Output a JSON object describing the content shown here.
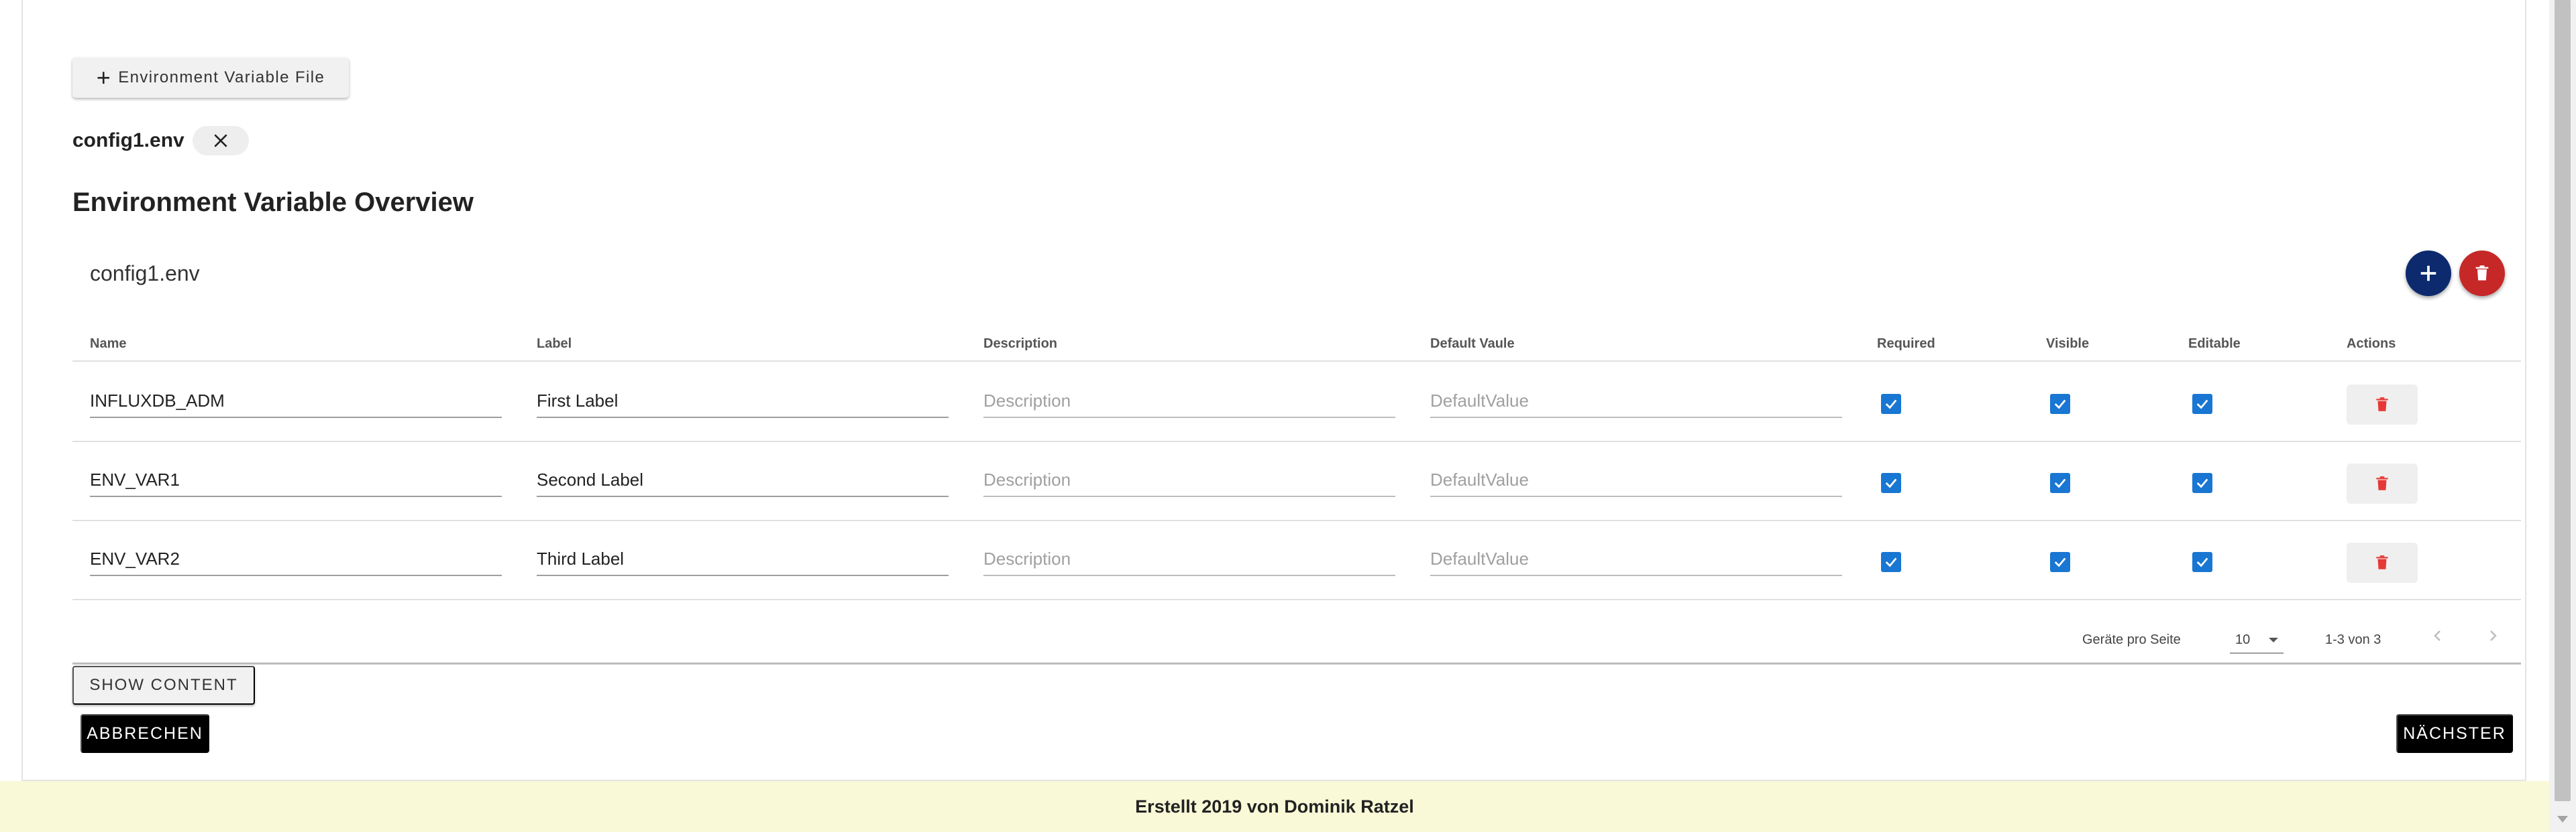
{
  "toolbar": {
    "add_env_file_label": "Environment Variable File",
    "add_icon": "plus-icon"
  },
  "file_chip": {
    "name": "config1.env",
    "remove_icon": "close-icon"
  },
  "overview": {
    "title": "Environment Variable Overview",
    "table_title": "config1.env",
    "add_icon": "plus-icon",
    "delete_all_icon": "trash-icon",
    "columns": [
      "Name",
      "Label",
      "Description",
      "Default Vaule",
      "Required",
      "Visible",
      "Editable",
      "Actions"
    ],
    "description_placeholder": "Description",
    "default_value_placeholder": "DefaultValue",
    "rows": [
      {
        "name": "INFLUXDB_ADM",
        "label": "First Label",
        "required": true,
        "visible": true,
        "editable": true
      },
      {
        "name": "ENV_VAR1",
        "label": "Second Label",
        "required": true,
        "visible": true,
        "editable": true
      },
      {
        "name": "ENV_VAR2",
        "label": "Third Label",
        "required": true,
        "visible": true,
        "editable": true
      }
    ]
  },
  "pagination": {
    "rows_per_page_label": "Geräte pro Seite",
    "rows_per_page_value": "10",
    "range_label": "1-3 von 3",
    "prev_icon": "chevron-left-icon",
    "next_icon": "chevron-right-icon"
  },
  "actions": {
    "show_content_label": "SHOW CONTENT",
    "cancel_label": "ABBRECHEN",
    "next_label": "NÄCHSTER"
  },
  "footer": {
    "text": "Erstellt 2019 von Dominik Ratzel"
  },
  "colors": {
    "primary_fab": "#0d2a6e",
    "danger": "#c62828",
    "checkbox": "#1976d2",
    "footer_bg": "#f9f9d7"
  }
}
